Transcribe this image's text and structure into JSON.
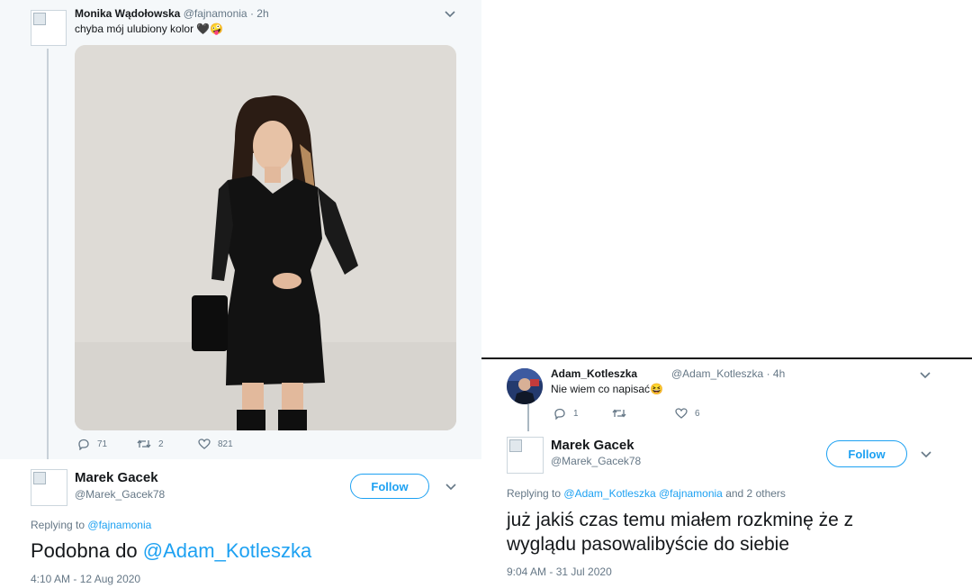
{
  "left_tweet": {
    "author_name": "Monika Wądołowska",
    "handle": "@fajnamonia",
    "time": "· 2h",
    "text": "chyba mój ulubiony kolor 🖤🤪",
    "replies": "71",
    "retweets": "2",
    "likes": "821"
  },
  "left_reply": {
    "author_name": "Marek Gacek",
    "handle": "@Marek_Gacek78",
    "follow_label": "Follow",
    "replying_prefix": "Replying to",
    "replying_to": "@fajnamonia",
    "text_prefix": "Podobna do",
    "text_mention": "@Adam_Kotleszka",
    "timestamp": "4:10 AM - 12 Aug 2020"
  },
  "right_tweet": {
    "author_name": "Adam_Kotleszka",
    "handle": "@Adam_Kotleszka",
    "time": "· 4h",
    "text": "Nie wiem co napisać😆",
    "replies": "1",
    "retweets": "",
    "likes": "6"
  },
  "right_reply": {
    "author_name": "Marek Gacek",
    "handle": "@Marek_Gacek78",
    "follow_label": "Follow",
    "replying_prefix": "Replying to",
    "replying_to_1": "@Adam_Kotleszka",
    "replying_to_2": "@fajnamonia",
    "replying_suffix": "and 2 others",
    "text_line1": "już jakiś czas temu miałem rozkminę że z",
    "text_line2": "wyglądu pasowalibyście do siebie",
    "timestamp": "9:04 AM - 31 Jul 2020"
  },
  "colors": {
    "accent": "#1da1f2",
    "muted": "#657786",
    "left_bg": "#f5f8fa"
  }
}
